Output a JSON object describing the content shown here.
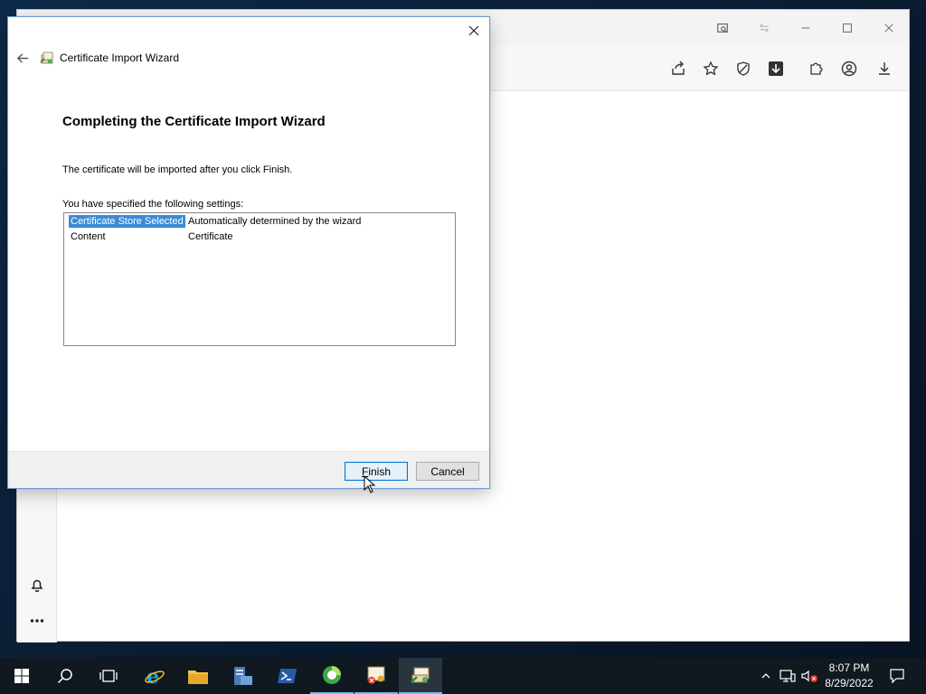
{
  "dialog": {
    "title": "Certificate Import Wizard",
    "heading": "Completing the Certificate Import Wizard",
    "info": "The certificate will be imported after you click Finish.",
    "settings_label": "You have specified the following settings:",
    "settings": [
      {
        "name": "Certificate Store Selected",
        "value": "Automatically determined by the wizard"
      },
      {
        "name": "Content",
        "value": "Certificate"
      }
    ],
    "finish_label": "Finish",
    "finish_mnemonic": "F",
    "finish_rest": "inish",
    "cancel_label": "Cancel"
  },
  "taskbar": {
    "time": "8:07 PM",
    "date": "8/29/2022"
  },
  "colors": {
    "selection": "#3a8ad6",
    "taskbar": "#101820",
    "accent": "#0078d7"
  },
  "icons": [
    "windows-start-icon",
    "search-icon",
    "task-view-icon",
    "internet-explorer-icon",
    "file-explorer-icon",
    "server-manager-icon",
    "powershell-icon",
    "app-green-icon",
    "certificate-app-icon",
    "certificate-import-icon",
    "chevron-up-icon",
    "network-icon",
    "volume-muted-icon",
    "notification-icon",
    "bell-icon",
    "more-icon"
  ]
}
